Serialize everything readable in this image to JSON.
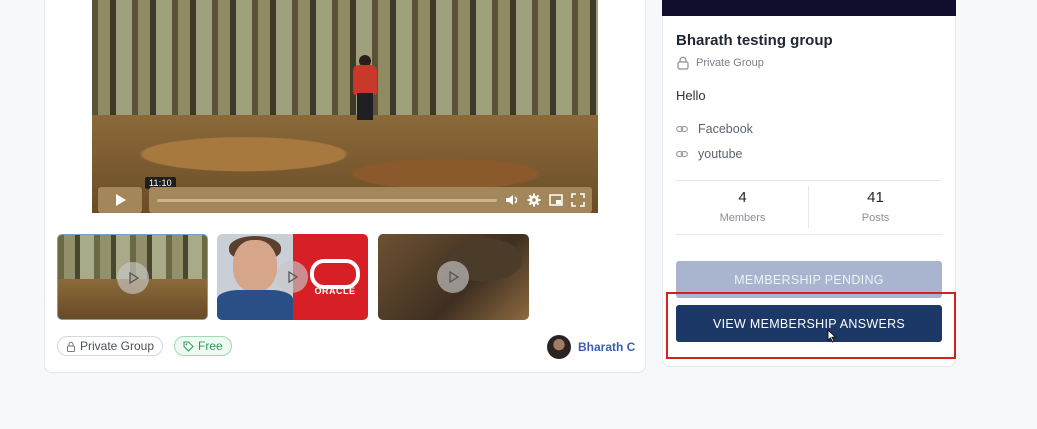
{
  "video": {
    "time_tooltip": "11:10",
    "icons": [
      "play-icon",
      "volume-icon",
      "settings-icon",
      "pip-icon",
      "fullscreen-icon"
    ]
  },
  "thumbnails": [
    {
      "name": "forest-video-thumbnail"
    },
    {
      "name": "oracle-video-thumbnail",
      "brand_text": "ORACLE"
    },
    {
      "name": "dark-video-thumbnail"
    }
  ],
  "post_meta": {
    "privacy_tag": "Private Group",
    "price_tag": "Free",
    "author_name": "Bharath C"
  },
  "group": {
    "title": "Bharath testing group",
    "privacy": "Private Group",
    "description": "Hello",
    "links": [
      {
        "label": "Facebook"
      },
      {
        "label": "youtube"
      }
    ],
    "stats": [
      {
        "value": "4",
        "label": "Members"
      },
      {
        "value": "41",
        "label": "Posts"
      }
    ],
    "pending_button": "MEMBERSHIP PENDING",
    "answers_button": "VIEW MEMBERSHIP ANSWERS"
  },
  "colors": {
    "primary_button": "#1c3866",
    "pending_button": "#a9b5cf",
    "highlight": "#d61f1f",
    "free_tag": "#2f9a58",
    "author_link": "#3a5fb0"
  }
}
